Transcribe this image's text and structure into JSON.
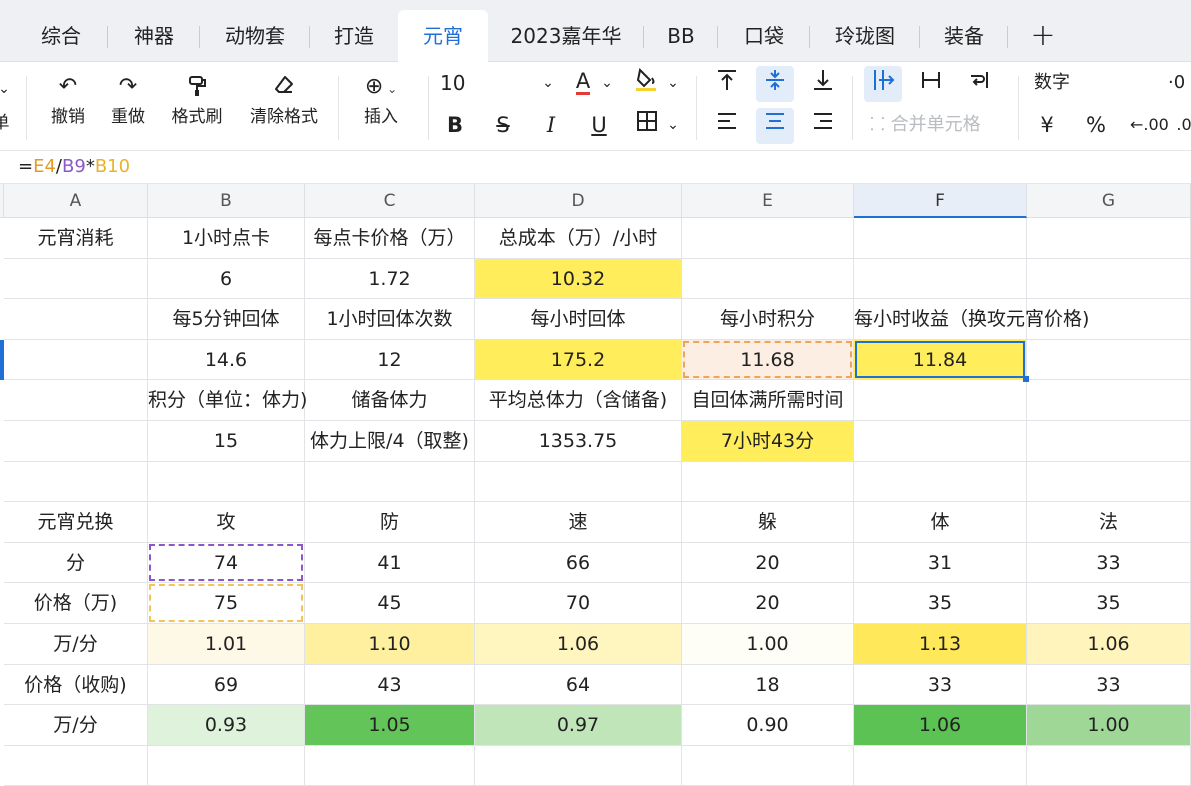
{
  "tabs": [
    "综合",
    "神器",
    "动物套",
    "打造",
    "元宵",
    "2023嘉年华",
    "BB",
    "口袋",
    "玲珑图",
    "装备",
    "+"
  ],
  "active_tab": "元宵",
  "toolbar": {
    "left_partial": "单",
    "undo": "撤销",
    "redo": "重做",
    "format_painter": "格式刷",
    "clear_format": "清除格式",
    "insert": "插入",
    "font_size": "10",
    "merge_cells": "合并单元格",
    "number_format": "数字",
    "yuan": "¥",
    "percent": "%"
  },
  "formula": {
    "prefix": "=",
    "ref1": "E4",
    "op1": "/",
    "ref2": "B9",
    "op2": "*",
    "ref3": "B10"
  },
  "columns": [
    "A",
    "B",
    "C",
    "D",
    "E",
    "F",
    "G"
  ],
  "rows": [
    [
      "元宵消耗",
      "1小时点卡",
      "每点卡价格（万）",
      "总成本（万）/小时",
      "",
      "",
      ""
    ],
    [
      "",
      "6",
      "1.72",
      "10.32",
      "",
      "",
      ""
    ],
    [
      "",
      "每5分钟回体",
      "1小时回体次数",
      "每小时回体",
      "每小时积分",
      "每小时收益（换攻元宵价格)",
      ""
    ],
    [
      "",
      "14.6",
      "12",
      "175.2",
      "11.68",
      "11.84",
      ""
    ],
    [
      "",
      "积分（单位：体力)",
      "储备体力",
      "平均总体力（含储备)",
      "自回体满所需时间",
      "",
      ""
    ],
    [
      "",
      "15",
      "体力上限/4（取整)",
      "1353.75",
      "7小时43分",
      "",
      ""
    ],
    [
      "",
      "",
      "",
      "",
      "",
      "",
      ""
    ],
    [
      "元宵兑换",
      "攻",
      "防",
      "速",
      "躲",
      "体",
      "法"
    ],
    [
      "分",
      "74",
      "41",
      "66",
      "20",
      "31",
      "33"
    ],
    [
      "价格（万)",
      "75",
      "45",
      "70",
      "20",
      "35",
      "35"
    ],
    [
      "万/分",
      "1.01",
      "1.10",
      "1.06",
      "1.00",
      "1.13",
      "1.06"
    ],
    [
      "价格（收购)",
      "69",
      "43",
      "64",
      "18",
      "33",
      "33"
    ],
    [
      "万/分",
      "0.93",
      "1.05",
      "0.97",
      "0.90",
      "1.06",
      "1.00"
    ],
    [
      "",
      "",
      "",
      "",
      "",
      "",
      ""
    ]
  ],
  "colors": {
    "accent": "#1f6fd6",
    "yellow": "#ffed5c",
    "orange_fill": "#fdeee3",
    "scale_yellow": [
      "#fdf9e6",
      "#fff0a0",
      "#fff5bf",
      "#fffef6",
      "#ffe95a",
      "#fff4bb"
    ],
    "scale_green": [
      "#def2dc",
      "#63c45a",
      "#bfe5b9",
      "#ffffff",
      "#5cc253",
      "#9ed796"
    ]
  }
}
